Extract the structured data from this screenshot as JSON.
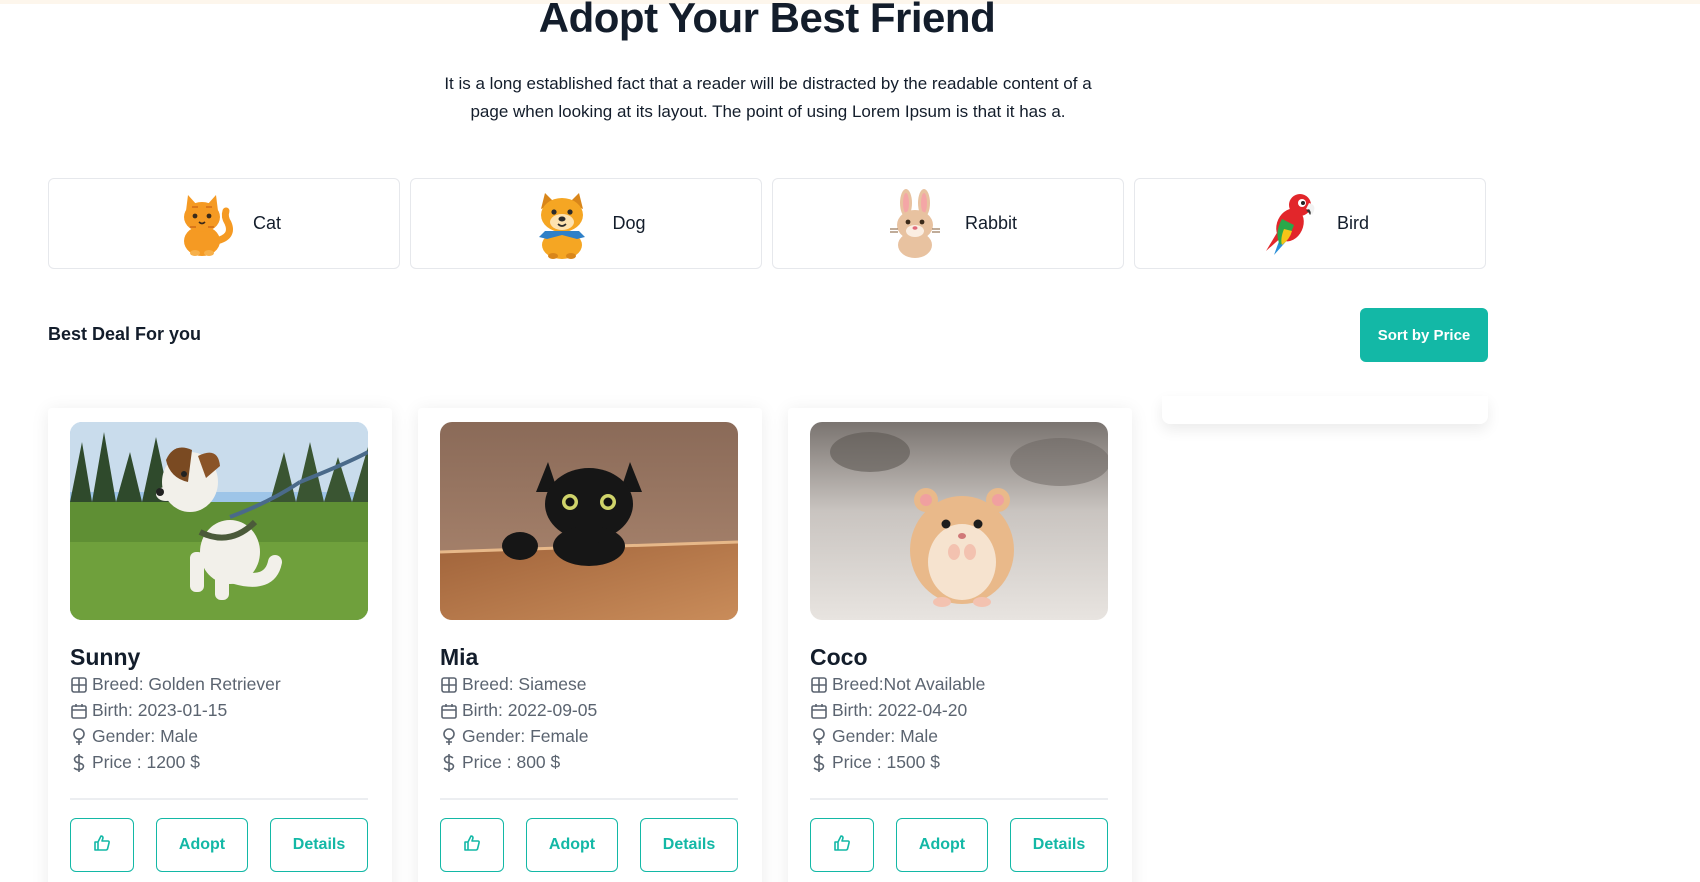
{
  "hero": {
    "title": "Adopt Your Best Friend",
    "description": "It is a long established fact that a reader will be distracted by the readable content of a page when looking at its layout. The point of using Lorem Ipsum is that it has a."
  },
  "categories": [
    {
      "label": "Cat",
      "icon": "cat-icon"
    },
    {
      "label": "Dog",
      "icon": "dog-icon"
    },
    {
      "label": "Rabbit",
      "icon": "rabbit-icon"
    },
    {
      "label": "Bird",
      "icon": "parrot-icon"
    }
  ],
  "section": {
    "title": "Best Deal For you",
    "sort_label": "Sort by Price"
  },
  "pets": [
    {
      "name": "Sunny",
      "breed": "Breed: Golden Retriever",
      "birth": "Birth: 2023-01-15",
      "gender": "Gender: Male",
      "price": "Price : 1200 $",
      "photo": "dog-photo",
      "adopt_label": "Adopt",
      "details_label": "Details"
    },
    {
      "name": "Mia",
      "breed": "Breed: Siamese",
      "birth": "Birth: 2022-09-05",
      "gender": "Gender: Female",
      "price": "Price : 800 $",
      "photo": "cat-photo",
      "adopt_label": "Adopt",
      "details_label": "Details"
    },
    {
      "name": "Coco",
      "breed": "Breed:Not Available",
      "birth": "Birth: 2022-04-20",
      "gender": "Gender: Male",
      "price": "Price : 1500 $",
      "photo": "hamster-photo",
      "adopt_label": "Adopt",
      "details_label": "Details"
    }
  ],
  "colors": {
    "accent": "#13b8a6",
    "text_dark": "#131d2b",
    "text_muted": "#5b6470"
  }
}
